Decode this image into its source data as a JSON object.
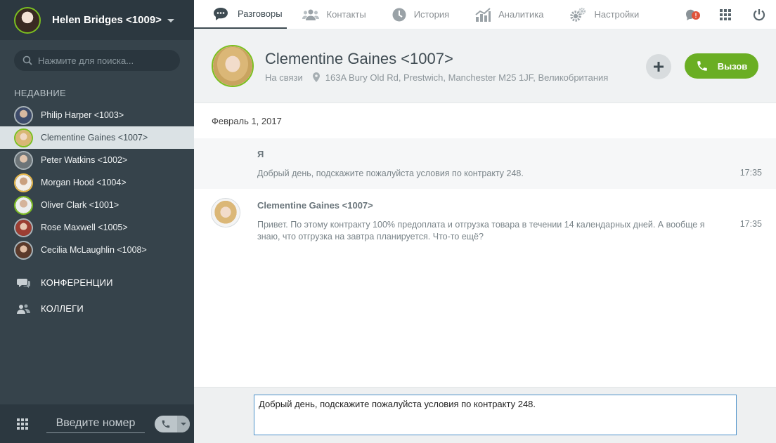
{
  "user": {
    "name": "Helen Bridges <1009>",
    "avatar_color": "#e9d6c8"
  },
  "search": {
    "placeholder": "Нажмите для поиска..."
  },
  "sidebar": {
    "recent_title": "НЕДАВНИЕ",
    "contacts": [
      {
        "name": "Philip Harper <1003>",
        "avatar_color": "#5d6a8a",
        "active": false
      },
      {
        "name": "Clementine Gaines <1007>",
        "avatar_color": "#e8c98e",
        "active": true
      },
      {
        "name": "Peter Watkins <1002>",
        "avatar_color": "#9aa3a8",
        "active": false
      },
      {
        "name": "Morgan Hood <1004>",
        "avatar_color": "#b98a6a",
        "active": false
      },
      {
        "name": "Oliver Clark <1001>",
        "avatar_color": "#8b8f93",
        "active": false
      },
      {
        "name": "Rose Maxwell <1005>",
        "avatar_color": "#b45a4e",
        "active": false
      },
      {
        "name": "Cecilia McLaughlin <1008>",
        "avatar_color": "#7e5a48",
        "active": false
      }
    ],
    "sections": [
      {
        "label": "КОНФЕРЕНЦИИ",
        "icon": "conference-icon"
      },
      {
        "label": "КОЛЛЕГИ",
        "icon": "colleagues-icon"
      }
    ]
  },
  "dialer": {
    "placeholder": "Введите номер"
  },
  "nav": {
    "tabs": [
      {
        "label": "Разговоры",
        "icon": "chat-icon",
        "active": true
      },
      {
        "label": "Контакты",
        "icon": "contacts-icon",
        "active": false
      },
      {
        "label": "История",
        "icon": "clock-icon",
        "active": false
      },
      {
        "label": "Аналитика",
        "icon": "analytics-icon",
        "active": false
      },
      {
        "label": "Настройки",
        "icon": "settings-icon",
        "active": false
      }
    ],
    "notification_badge": "!"
  },
  "contact_header": {
    "name": "Clementine Gaines <1007>",
    "status": "На связи",
    "address": "163A Bury Old Rd, Prestwich, Manchester M25 1JF, Великобритания",
    "call_label": "Вызов"
  },
  "conversation": {
    "date": "Февраль 1, 2017",
    "messages": [
      {
        "sender": "Я",
        "text": "Добрый день, подскажите пожалуйста условия по контракту 248.",
        "time": "17:35"
      },
      {
        "sender": "Clementine Gaines <1007>",
        "text": "Привет. По этому контракту 100% предоплата и отгрузка товара в течении 14 календарных дней. А вообще я знаю, что отгрузка на завтра планируется. Что-то ещё?",
        "time": "17:35"
      }
    ]
  },
  "composer": {
    "value": "Добрый день, подскажите пожалуйста условия по контракту 248."
  },
  "colors": {
    "accent_green": "#6aae23",
    "sidebar_bg": "#36434b",
    "notification_red": "#e0533a"
  }
}
